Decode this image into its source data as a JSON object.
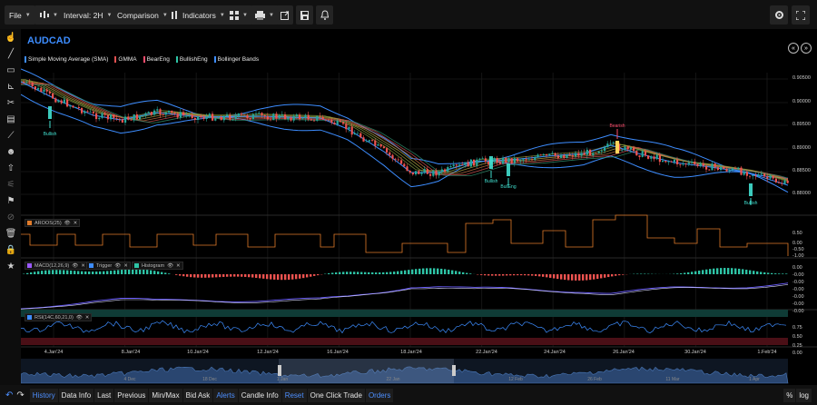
{
  "toolbar": {
    "file_label": "File",
    "interval_label": "Interval: 2H",
    "comparison_label": "Comparison",
    "indicators_label": "Indicators"
  },
  "chart": {
    "symbol": "AUDCAD",
    "legend": [
      {
        "label": "Simple Moving Average (SMA)",
        "color": "#3d8dff"
      },
      {
        "label": "GMMA",
        "color": "#e05050"
      },
      {
        "label": "BearEng",
        "color": "#ff4d6d"
      },
      {
        "label": "BullishEng",
        "color": "#2ec4a6"
      },
      {
        "label": "Bollinger Bands",
        "color": "#3d8dff"
      }
    ],
    "price_ticks": [
      "0.90500",
      "0.90000",
      "0.89500",
      "0.89000",
      "0.88500",
      "0.88000"
    ],
    "patterns": {
      "bullish": "Bullish",
      "bearish": "Bearish",
      "bullish_eng": "BullEng"
    },
    "colors": {
      "up": "#26a69a",
      "down": "#ef5350",
      "band": "#3d8dff",
      "accent": "#3d8dff"
    }
  },
  "indicators": {
    "aroon": {
      "label": "AROOS(25)",
      "ticks": [
        "0.50",
        "0.00",
        "-0.50",
        "-1.00"
      ],
      "color": "#e07b2a"
    },
    "macd": {
      "label": "MACD(12,26,9)",
      "trigger": "Trigger",
      "histogram": "Histogram",
      "ticks": [
        "0.00",
        "-0.00",
        "-0.00",
        "-0.00",
        "-0.00",
        "-0.00",
        "-0.00"
      ],
      "color": "#9b59ff"
    },
    "rsi": {
      "label": "RSI(14C,60,21,0)",
      "ticks": [
        "0.75",
        "0.50",
        "0.25",
        "0.00"
      ],
      "color": "#3d8dff"
    }
  },
  "time_axis": [
    "4.Jan'24",
    "8.Jan'24",
    "10.Jan'24",
    "12.Jan'24",
    "16.Jan'24",
    "18.Jan'24",
    "22.Jan'24",
    "24.Jan'24",
    "26.Jan'24",
    "30.Jan'24",
    "1.Feb'24"
  ],
  "navigator_axis": [
    "4 Dec",
    "18 Dec",
    "1 Jan",
    "22 Jan",
    "12 Feb",
    "26 Feb",
    "11 Mar",
    "1 Apr"
  ],
  "bottombar": {
    "history": "History",
    "data_info": "Data Info",
    "last": "Last",
    "previous": "Previous",
    "minmax": "Min/Max",
    "bid_ask": "Bid Ask",
    "alerts": "Alerts",
    "candle_info": "Candle Info",
    "reset": "Reset",
    "one_click": "One Click Trade",
    "orders": "Orders",
    "percent": "%",
    "log": "log"
  }
}
